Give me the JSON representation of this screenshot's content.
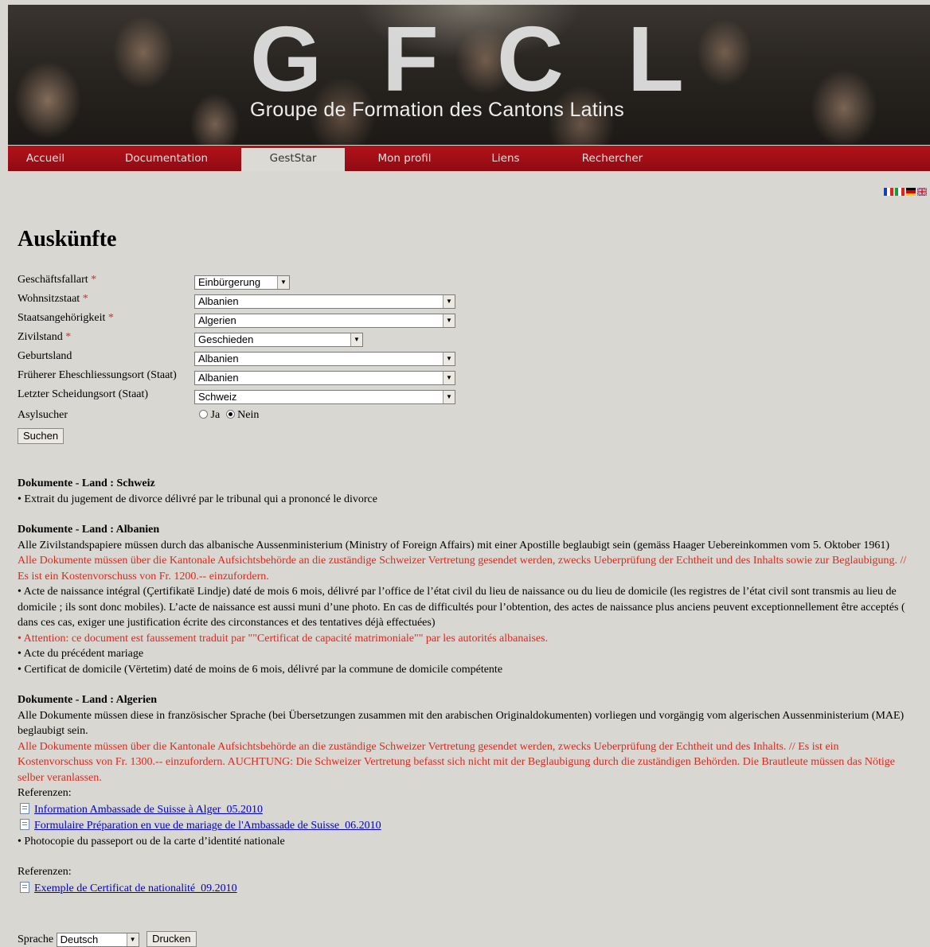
{
  "banner": {
    "letters": [
      "G",
      "F",
      "C",
      "L"
    ],
    "subtitle": "Groupe de Formation des Cantons Latins"
  },
  "nav": {
    "items": [
      {
        "label": "Accueil",
        "active": false
      },
      {
        "label": "Documentation",
        "active": false
      },
      {
        "label": "GestStar",
        "active": true
      },
      {
        "label": "Mon profil",
        "active": false
      },
      {
        "label": "Liens",
        "active": false
      },
      {
        "label": "Rechercher",
        "active": false
      }
    ]
  },
  "flags": [
    {
      "name": "fr-flag",
      "colors": [
        "#1f3fa8",
        "#ffffff",
        "#e1251b"
      ]
    },
    {
      "name": "it-flag",
      "colors": [
        "#1a9b3b",
        "#ffffff",
        "#d9251b"
      ]
    },
    {
      "name": "de-flag",
      "colors": [
        "#000000",
        "#dd0000",
        "#ffce00"
      ]
    },
    {
      "name": "uk-flag",
      "colors": [
        "#1d3b8c",
        "#ffffff",
        "#d0121a"
      ]
    }
  ],
  "page": {
    "title": "Auskünfte"
  },
  "form": {
    "geschaeftsfallart": {
      "label": "Geschäftsfallart",
      "required": "*",
      "value": "Einbürgerung"
    },
    "wohnsitzstaat": {
      "label": "Wohnsitzstaat",
      "required": "*",
      "value": "Albanien"
    },
    "staatsangehoerigkeit": {
      "label": "Staatsangehörigkeit",
      "required": "*",
      "value": "Algerien"
    },
    "zivilstand": {
      "label": "Zivilstand",
      "required": "*",
      "value": "Geschieden"
    },
    "geburtsland": {
      "label": "Geburtsland",
      "value": "Albanien"
    },
    "eheschliessungsort": {
      "label": "Früherer Eheschliessungsort (Staat)",
      "value": "Albanien"
    },
    "scheidungsort": {
      "label": "Letzter Scheidungsort (Staat)",
      "value": "Schweiz"
    },
    "asylsucher": {
      "label": "Asylsucher",
      "option_yes": "Ja",
      "option_no": "Nein",
      "selected": "Nein"
    },
    "search_button": "Suchen"
  },
  "results": {
    "schweiz": {
      "title": "Dokumente - Land : Schweiz",
      "items": [
        "• Extrait du jugement de divorce délivré par le tribunal qui a prononcé le divorce"
      ]
    },
    "albanien": {
      "title": "Dokumente - Land : Albanien",
      "intro": "Alle Zivilstandspapiere müssen durch das albanische Aussenministerium (Ministry of Foreign Affairs) mit einer Apostille beglaubigt sein (gemäss Haager Uebereinkommen vom 5. Oktober 1961)",
      "note": "Alle Dokumente müssen über die Kantonale Aufsichtsbehörde an die zuständige Schweizer Vertretung gesendet werden, zwecks Ueberprüfung der Echtheit und des Inhalts sowie zur Beglaubigung. // Es ist ein Kostenvorschuss von Fr. 1200.-- einzufordern.",
      "item1": "• Acte de naissance intégral (Çertifikatë Lindje) daté de mois 6 mois, délivré par l’office de l’état civil du lieu de naissance ou du lieu de domicile (les registres de l’état civil sont transmis au lieu de domicile ; ils sont donc mobiles). L’acte de naissance est aussi muni d’une photo. En cas de difficultés pour l’obtention, des actes de naissance plus anciens peuvent exceptionnellement être acceptés ( dans ces cas, exiger une justification écrite des circonstances et des tentatives déjà effectuées)",
      "warning": "• Attention: ce document est faussement traduit par \"\"Certificat de capacité matrimoniale\"\" par les autorités albanaises.",
      "item2": "• Acte du précédent mariage",
      "item3": "• Certificat de domicile (Vërtetim) daté de moins de 6 mois, délivré par la commune de domicile compétente"
    },
    "algerien": {
      "title": "Dokumente - Land : Algerien",
      "intro": "Alle Dokumente müssen diese in französischer Sprache (bei Übersetzungen zusammen mit den arabischen Originaldokumenten) vorliegen und vorgängig vom algerischen Aussenministerium (MAE) beglaubigt sein.",
      "note": "Alle Dokumente müssen über die Kantonale Aufsichtsbehörde an die zuständige Schweizer Vertretung gesendet werden, zwecks Ueberprüfung der Echtheit und des Inhalts. // Es ist ein Kostenvorschuss von Fr. 1300.-- einzufordern. AUCHTUNG: Die Schweizer Vertretung befasst sich nicht mit der Beglaubigung durch die zuständigen Behörden. Die Brautleute müssen das Nötige selber veranlassen.",
      "ref_label": "Referenzen:",
      "links": [
        "Information Ambassade de Suisse à Alger_05.2010",
        "Formulaire Préparation en vue de mariage de l'Ambassade de Suisse_06.2010"
      ],
      "item1": "• Photocopie du passeport ou de la carte d’identité nationale",
      "ref_label2": "Referenzen:",
      "link3": "Exemple de Certificat de nationalité_09.2010"
    }
  },
  "footer": {
    "language_label": "Sprache",
    "language_value": "Deutsch",
    "print_button": "Drucken"
  }
}
